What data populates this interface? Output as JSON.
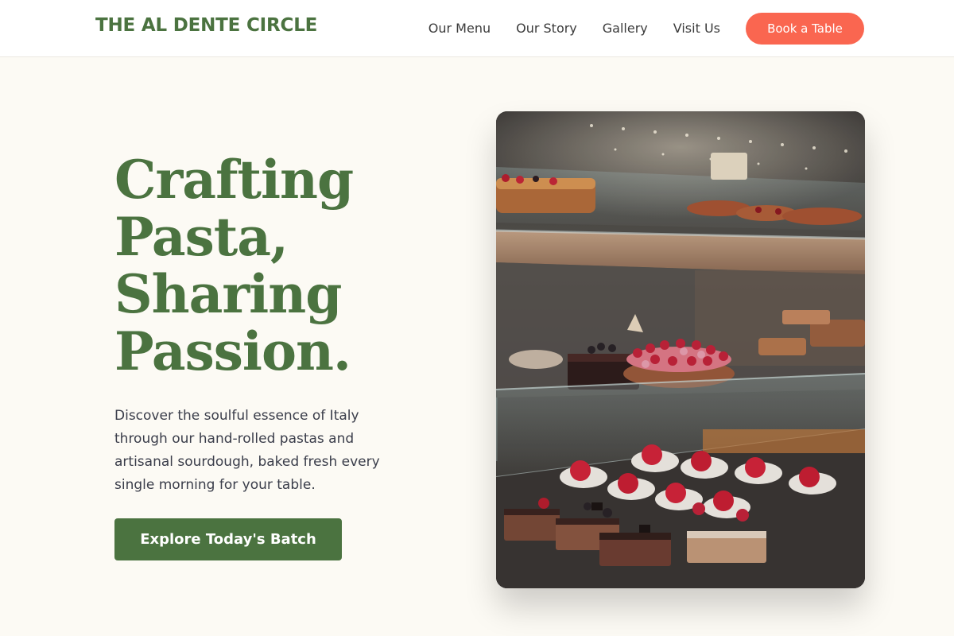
{
  "brand": {
    "name": "THE AL DENTE CIRCLE"
  },
  "nav": {
    "links": [
      "Our Menu",
      "Our Story",
      "Gallery",
      "Visit Us"
    ],
    "cta_label": "Book a Table"
  },
  "hero": {
    "headline_lines": [
      "Crafting",
      "Pasta,",
      "Sharing",
      "Passion."
    ],
    "description": "Discover the soulful essence of Italy through our hand-rolled pastas and artisanal sourdough, baked fresh every single morning for your table.",
    "cta_label": "Explore Today's Batch",
    "image_alt": "photo of pastries and tarts displayed in a glass bakery case"
  },
  "colors": {
    "brand_green": "#4b7340",
    "accent_coral": "#fa6650",
    "page_background": "#fcfaf4"
  }
}
